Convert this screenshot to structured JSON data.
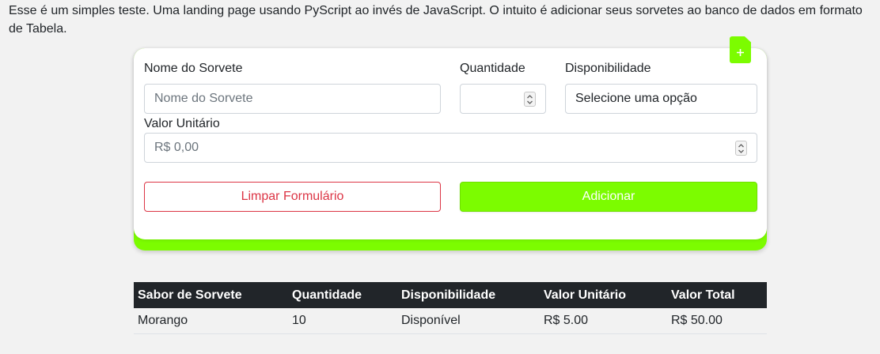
{
  "intro": "Esse é um simples teste. Uma landing page usando PyScript ao invés de JavaScript. O intuito é adicionar seus sorvetes ao banco de dados em formato de Tabela.",
  "form": {
    "name_label": "Nome do Sorvete",
    "name_placeholder": "Nome do Sorvete",
    "qty_label": "Quantidade",
    "qty_value": "",
    "avail_label": "Disponibilidade",
    "avail_selected": "Selecione uma opção",
    "price_label": "Valor Unitário",
    "price_placeholder": "R$ 0,00",
    "clear_label": "Limpar Formulário",
    "add_label": "Adicionar",
    "badge_icon": "file-plus-icon"
  },
  "table": {
    "headers": [
      "Sabor de Sorvete",
      "Quantidade",
      "Disponibilidade",
      "Valor Unitário",
      "Valor Total"
    ],
    "rows": [
      [
        "Morango",
        "10",
        "Disponível",
        "R$ 5.00",
        "R$ 50.00"
      ]
    ]
  },
  "colors": {
    "accent": "#7cfc00",
    "danger": "#dc3545",
    "table_header": "#212529"
  }
}
